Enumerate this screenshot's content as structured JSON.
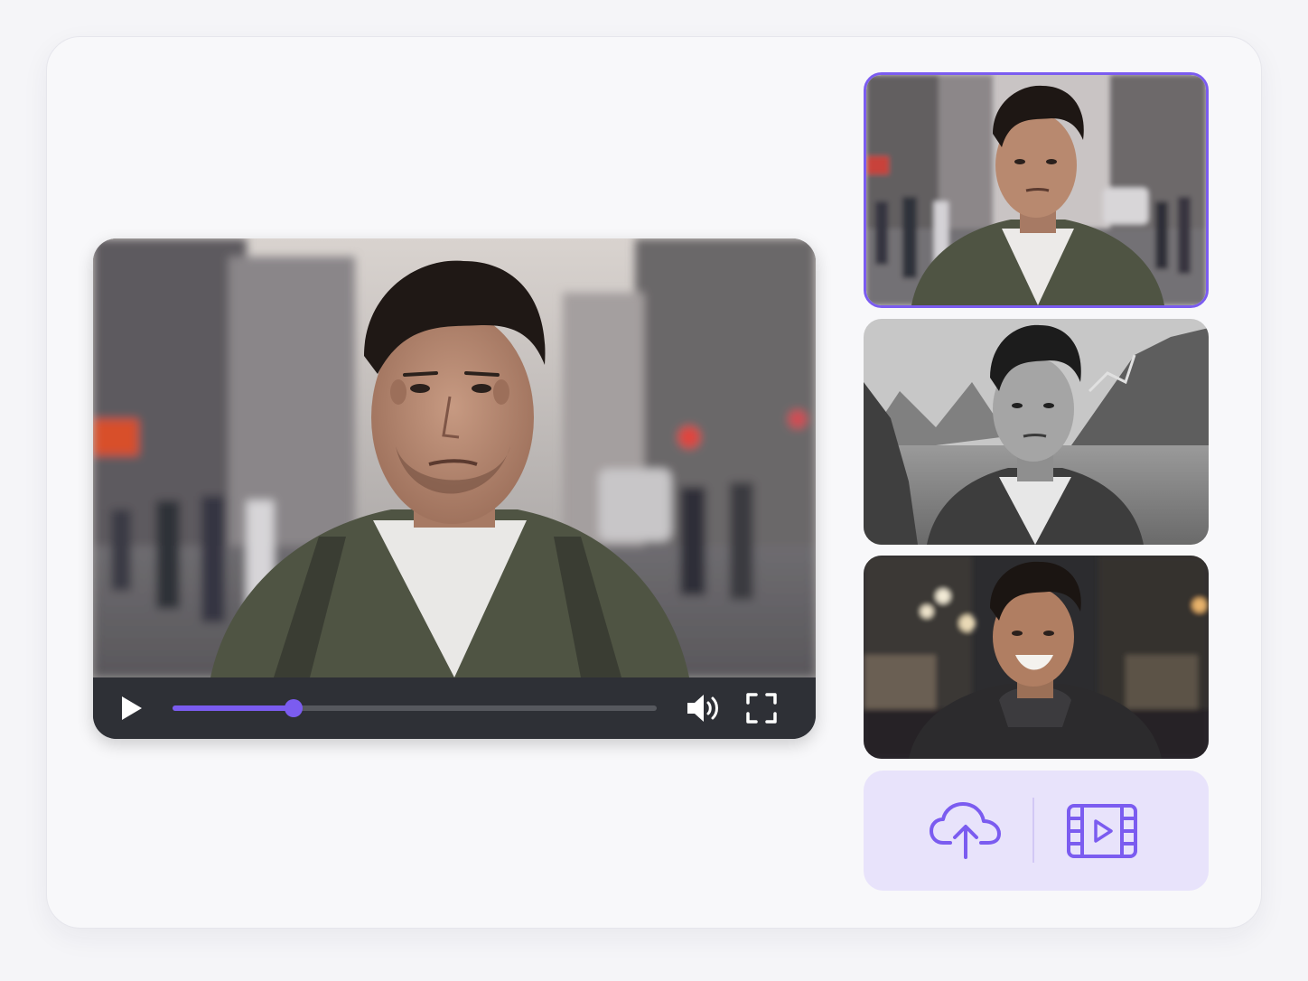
{
  "player": {
    "progress_fraction": 0.25,
    "icons": {
      "play": "play-icon",
      "volume": "volume-icon",
      "fullscreen": "fullscreen-icon"
    }
  },
  "thumbnails": [
    {
      "variant": "city-street-color",
      "selected": true
    },
    {
      "variant": "mountain-lake-bw",
      "selected": false
    },
    {
      "variant": "night-street-smiling",
      "selected": false
    }
  ],
  "actions": {
    "icons": {
      "upload": "cloud-upload-icon",
      "video": "video-film-icon"
    }
  },
  "colors": {
    "accent": "#7b5cf0",
    "accent_light": "#e8e3fb",
    "control_bar": "#2e3036",
    "card_bg": "#f8f8fa"
  }
}
